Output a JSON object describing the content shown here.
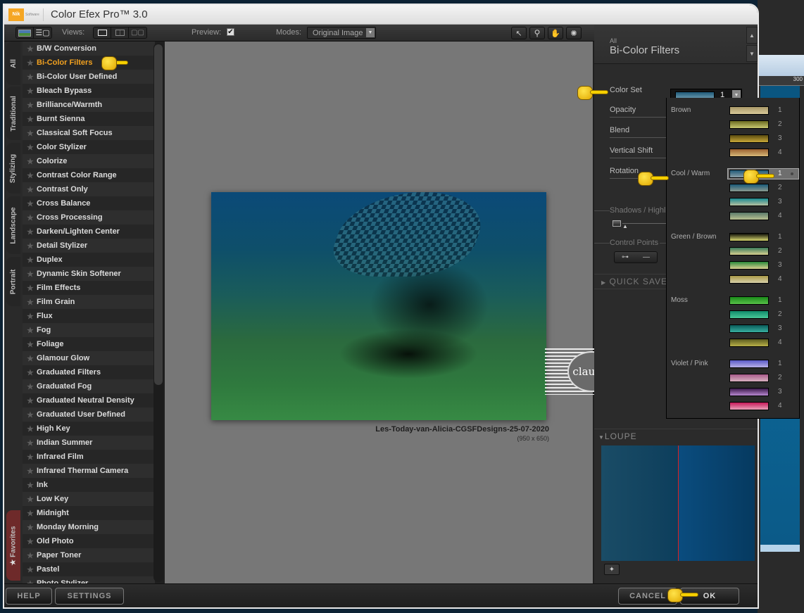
{
  "app": {
    "logo_text": "Nik",
    "logo_sub": "Software",
    "title": "Color Efex Pro™ 3.0"
  },
  "toolbar": {
    "views_label": "Views:",
    "preview_label": "Preview:",
    "preview_checked": true,
    "modes_label": "Modes:",
    "modes_value": "Original Image",
    "tools": [
      {
        "icon": "arrow-pointer-icon",
        "glyph": "↖"
      },
      {
        "icon": "zoom-icon",
        "glyph": "🔍︎"
      },
      {
        "icon": "hand-pan-icon",
        "glyph": "✋︎"
      },
      {
        "icon": "lightbulb-icon",
        "glyph": "✺"
      }
    ]
  },
  "side_tabs": [
    "All",
    "Traditional",
    "Stylizing",
    "Landscape",
    "Portrait",
    "Favorites"
  ],
  "filters": {
    "selected": "Bi-Color Filters",
    "items": [
      "B/W Conversion",
      "Bi-Color Filters",
      "Bi-Color User Defined",
      "Bleach Bypass",
      "Brilliance/Warmth",
      "Burnt Sienna",
      "Classical Soft Focus",
      "Color Stylizer",
      "Colorize",
      "Contrast Color Range",
      "Contrast Only",
      "Cross Balance",
      "Cross Processing",
      "Darken/Lighten Center",
      "Detail Stylizer",
      "Duplex",
      "Dynamic Skin Softener",
      "Film Effects",
      "Film Grain",
      "Flux",
      "Fog",
      "Foliage",
      "Glamour Glow",
      "Graduated Filters",
      "Graduated Fog",
      "Graduated Neutral Density",
      "Graduated User Defined",
      "High Key",
      "Indian Summer",
      "Infrared Film",
      "Infrared Thermal Camera",
      "Ink",
      "Low Key",
      "Midnight",
      "Monday Morning",
      "Old Photo",
      "Paper Toner",
      "Pastel",
      "Photo Stylizer"
    ]
  },
  "preview": {
    "image_name": "Les-Today-van-Alicia-CGSFDesigns-25-07-2020",
    "image_dims": "(950 x 650)",
    "watermark_text": "claudia"
  },
  "panel": {
    "category": "All",
    "filter_title": "Bi-Color Filters",
    "params": {
      "color_set_label": "Color Set",
      "color_set_value": "1",
      "opacity_label": "Opacity",
      "blend_label": "Blend",
      "vertical_shift_label": "Vertical Shift",
      "rotation_label": "Rotation"
    },
    "shadows_label": "Shadows / Highli",
    "control_points_label": "Control Points",
    "quick_save_label": "QUICK SAVE",
    "loupe_label": "LOUPE"
  },
  "color_set_dropdown": {
    "selected_group": "Cool / Warm",
    "selected_index": 1,
    "groups": [
      {
        "name": "Brown",
        "sets": [
          {
            "num": "1",
            "top": "#a89868",
            "bottom": "#d8c898"
          },
          {
            "num": "2",
            "top": "#6a6a20",
            "bottom": "#c8c870"
          },
          {
            "num": "3",
            "top": "#5a4a10",
            "bottom": "#c8a838"
          },
          {
            "num": "4",
            "top": "#9a6030",
            "bottom": "#d8b878"
          }
        ]
      },
      {
        "name": "Cool / Warm",
        "sets": [
          {
            "num": "1",
            "top": "#1f5a78",
            "bottom": "#8aa0a8"
          },
          {
            "num": "2",
            "top": "#1a5a78",
            "bottom": "#8a9a90"
          },
          {
            "num": "3",
            "top": "#1a8a90",
            "bottom": "#b8c0a0"
          },
          {
            "num": "4",
            "top": "#5a7a6a",
            "bottom": "#b8c090"
          }
        ]
      },
      {
        "name": "Green / Brown",
        "sets": [
          {
            "num": "1",
            "top": "#101008",
            "bottom": "#d8d870"
          },
          {
            "num": "2",
            "top": "#3a7a5a",
            "bottom": "#d8d090"
          },
          {
            "num": "3",
            "top": "#2a8a3a",
            "bottom": "#d8d090"
          },
          {
            "num": "4",
            "top": "#a89848",
            "bottom": "#d8d0a8"
          }
        ]
      },
      {
        "name": "Moss",
        "sets": [
          {
            "num": "1",
            "top": "#1a8a1a",
            "bottom": "#58c048"
          },
          {
            "num": "2",
            "top": "#108a6a",
            "bottom": "#48c898"
          },
          {
            "num": "3",
            "top": "#0a5a5a",
            "bottom": "#38b0a0"
          },
          {
            "num": "4",
            "top": "#5a5a20",
            "bottom": "#b8b048"
          }
        ]
      },
      {
        "name": "Violet / Pink",
        "sets": [
          {
            "num": "1",
            "top": "#5a5ac8",
            "bottom": "#b8b0e8"
          },
          {
            "num": "2",
            "top": "#a85a8a",
            "bottom": "#d8b0c0"
          },
          {
            "num": "3",
            "top": "#3a1a4a",
            "bottom": "#b888d0"
          },
          {
            "num": "4",
            "top": "#c81a5a",
            "bottom": "#e8a0b8"
          }
        ]
      }
    ]
  },
  "bottom": {
    "help_label": "HELP",
    "settings_label": "SETTINGS",
    "cancel_label": "CANCEL",
    "ok_label": "OK"
  },
  "host": {
    "ruler_label": "300"
  }
}
